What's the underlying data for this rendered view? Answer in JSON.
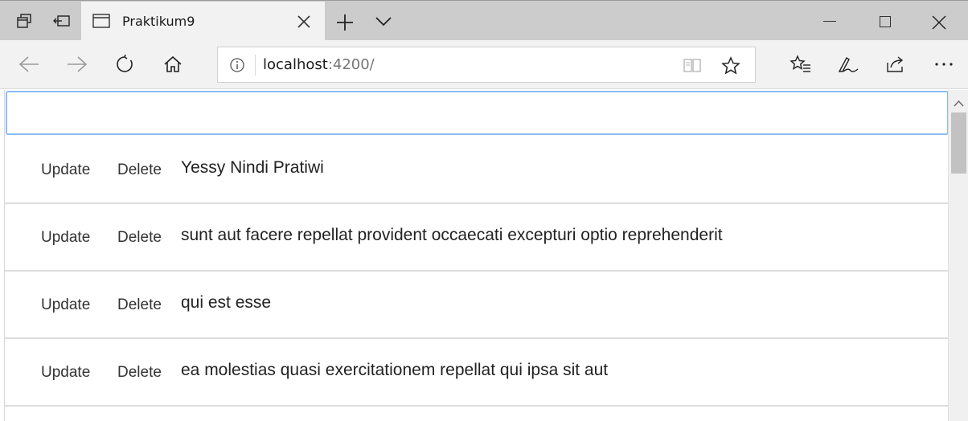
{
  "tab": {
    "title": "Praktikum9",
    "favicon_icon": "window-icon"
  },
  "address": {
    "host": "localhost",
    "port": ":4200/"
  },
  "search": {
    "value": "",
    "placeholder": ""
  },
  "list": {
    "items": [
      {
        "update_label": "Update",
        "delete_label": "Delete",
        "title": "Yessy Nindi Pratiwi"
      },
      {
        "update_label": "Update",
        "delete_label": "Delete",
        "title": "sunt aut facere repellat provident occaecati excepturi optio reprehenderit"
      },
      {
        "update_label": "Update",
        "delete_label": "Delete",
        "title": "qui est esse"
      },
      {
        "update_label": "Update",
        "delete_label": "Delete",
        "title": "ea molestias quasi exercitationem repellat qui ipsa sit aut"
      }
    ]
  },
  "colors": {
    "titlebar": "#cccccc",
    "active_tab": "#f2f2f2",
    "input_focus_border": "#8cbdf2"
  }
}
